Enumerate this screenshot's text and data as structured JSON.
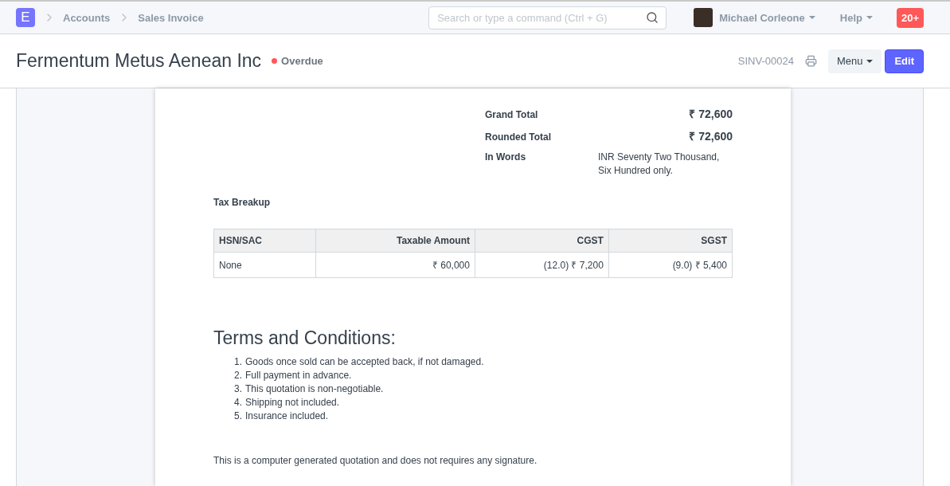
{
  "navbar": {
    "logo": "E",
    "breadcrumbs": [
      "Accounts",
      "Sales Invoice"
    ],
    "search": {
      "placeholder": "Search or type a command (Ctrl + G)"
    },
    "user": "Michael Corleone",
    "help": "Help",
    "notifications": "20+"
  },
  "page_header": {
    "title": "Fermentum Metus Aenean Inc",
    "status": {
      "label": "Overdue",
      "color": "#ff5858"
    },
    "doc_id": "SINV-00024",
    "menu": "Menu",
    "edit": "Edit"
  },
  "totals": [
    {
      "label": "Grand Total",
      "value": "₹ 72,600"
    },
    {
      "label": "Rounded Total",
      "value": "₹ 72,600"
    },
    {
      "label": "In Words",
      "value": "INR Seventy Two Thousand, Six Hundred only.",
      "kind": "words"
    }
  ],
  "tax_breakup": {
    "title": "Tax Breakup",
    "columns": [
      "HSN/SAC",
      "Taxable Amount",
      "CGST",
      "SGST"
    ],
    "rows": [
      [
        "None",
        "₹ 60,000",
        "(12.0) ₹ 7,200",
        "(9.0) ₹ 5,400"
      ]
    ]
  },
  "terms": {
    "title": "Terms and Conditions:",
    "items": [
      {
        "marker": "1.",
        "text": "Goods once sold can be accepted back, if not damaged."
      },
      {
        "marker": "2.",
        "text": "Full payment in advance."
      },
      {
        "marker": "3.",
        "text": "This quotation is non-negotiable."
      },
      {
        "marker": "4.",
        "text": "Shipping not included."
      },
      {
        "marker": "5.",
        "text": "Insurance included."
      }
    ]
  },
  "footer_note": "This is a computer generated quotation and does not requires any signature."
}
